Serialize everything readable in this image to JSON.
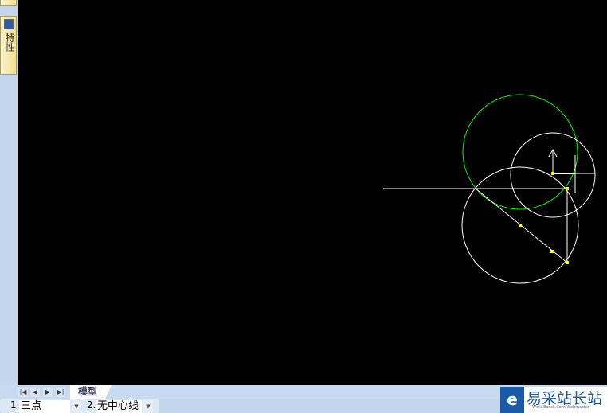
{
  "left_panel": {
    "properties_label": "特性",
    "icon": "properties-icon"
  },
  "layout_tabs": {
    "nav": [
      "first",
      "prev",
      "next",
      "last"
    ],
    "active_tab": "模型"
  },
  "status": {
    "item1_num": "1.",
    "item1_value": "三点",
    "item2_num": "2.",
    "item2_value": "无中心线"
  },
  "watermark": {
    "brand": "易采站长站",
    "sub": "Www.Easck.Com Webmaster"
  },
  "colors": {
    "background": "#000000",
    "green_circle": "#00ff00",
    "lines": "#ffffff",
    "grips": "#ffff00"
  }
}
